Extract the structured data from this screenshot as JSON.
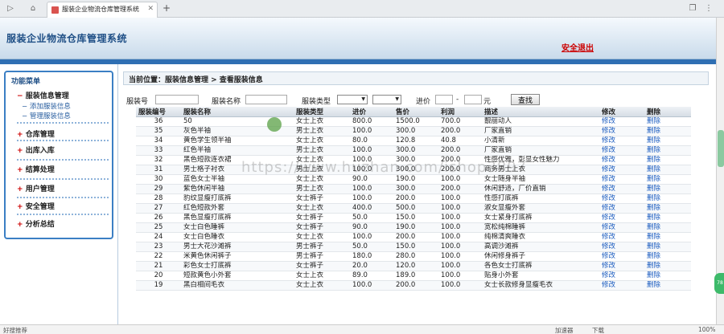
{
  "browser": {
    "tab_title": "服装企业物流仓库管理系统",
    "tab_close": "✕",
    "new_tab": "+",
    "status_left": "好搜推荐",
    "status_items": [
      "加速器",
      "下载",
      "100%"
    ]
  },
  "header": {
    "title": "服装企业物流仓库管理系统",
    "logout": "安全退出"
  },
  "menu": {
    "title": "功能菜单",
    "sections": [
      {
        "sign": "−",
        "label": "服装信息管理",
        "subs": [
          "添加服装信息",
          "管理服装信息"
        ]
      },
      {
        "sign": "+",
        "label": "仓库管理",
        "subs": []
      },
      {
        "sign": "+",
        "label": "出库入库",
        "subs": []
      },
      {
        "sign": "+",
        "label": "结算处理",
        "subs": []
      },
      {
        "sign": "+",
        "label": "用户管理",
        "subs": []
      },
      {
        "sign": "+",
        "label": "安全管理",
        "subs": []
      },
      {
        "sign": "+",
        "label": "分析总结",
        "subs": []
      }
    ]
  },
  "breadcrumb": "当前位置：服装信息管理 > 查看服装信息",
  "search": {
    "id_label": "服装号",
    "name_label": "服装名称",
    "type_label": "服装类型",
    "price_label": "进价",
    "dash": "-",
    "unit": "元",
    "button": "查找"
  },
  "table": {
    "headers": [
      "服装编号",
      "服装名称",
      "服装类型",
      "进价",
      "售价",
      "利润",
      "描述",
      "修改",
      "删除"
    ],
    "edit_label": "修改",
    "delete_label": "删除",
    "rows": [
      [
        "36",
        "50",
        "女士上衣",
        "800.0",
        "1500.0",
        "700.0",
        "靓丽动人"
      ],
      [
        "35",
        "灰色半袖",
        "男士上衣",
        "100.0",
        "300.0",
        "200.0",
        "厂家直销"
      ],
      [
        "34",
        "黄色学生领半袖",
        "女士上衣",
        "80.0",
        "120.8",
        "40.8",
        "小清新"
      ],
      [
        "33",
        "红色半袖",
        "男士上衣",
        "100.0",
        "300.0",
        "200.0",
        "厂家直销"
      ],
      [
        "32",
        "黑色短款连衣裙",
        "女士上衣",
        "100.0",
        "300.0",
        "200.0",
        "性感优雅，彰显女性魅力"
      ],
      [
        "31",
        "男士格子衬衣",
        "男士上衣",
        "100.0",
        "300.0",
        "200.0",
        "商务男士上衣"
      ],
      [
        "30",
        "蓝色女士半袖",
        "女士上衣",
        "90.0",
        "190.0",
        "100.0",
        "女士随身半袖"
      ],
      [
        "29",
        "紫色休闲半袖",
        "男士上衣",
        "100.0",
        "300.0",
        "200.0",
        "休闲舒适，厂价直销"
      ],
      [
        "28",
        "豹纹显瘦打底裤",
        "女士裤子",
        "100.0",
        "200.0",
        "100.0",
        "性感打底裤"
      ],
      [
        "27",
        "红色短款外套",
        "女士上衣",
        "400.0",
        "500.0",
        "100.0",
        "淑女显瘦外套"
      ],
      [
        "26",
        "黑色显瘦打底裤",
        "女士裤子",
        "50.0",
        "150.0",
        "100.0",
        "女士紧身打底裤"
      ],
      [
        "25",
        "女士白色睡裤",
        "女士裤子",
        "90.0",
        "190.0",
        "100.0",
        "宽松纯棉睡裤"
      ],
      [
        "24",
        "女士白色睡衣",
        "女士上衣",
        "100.0",
        "200.0",
        "100.0",
        "纯棉清爽睡衣"
      ],
      [
        "23",
        "男士大花沙滩裤",
        "男士裤子",
        "50.0",
        "150.0",
        "100.0",
        "高调沙滩裤"
      ],
      [
        "22",
        "米黄色休闲裤子",
        "男士裤子",
        "180.0",
        "280.0",
        "100.0",
        "休闲修身裤子"
      ],
      [
        "21",
        "彩色女士打底裤",
        "女士裤子",
        "20.0",
        "120.0",
        "100.0",
        "各色女士打底裤"
      ],
      [
        "20",
        "短款黄色小外套",
        "女士上衣",
        "89.0",
        "189.0",
        "100.0",
        "贴身小外套"
      ],
      [
        "19",
        "黑白相间毛衣",
        "女士上衣",
        "100.0",
        "200.0",
        "100.0",
        "女士长款修身显瘦毛衣"
      ]
    ]
  },
  "watermark": "https://www.huzhan.com/ishop3897"
}
